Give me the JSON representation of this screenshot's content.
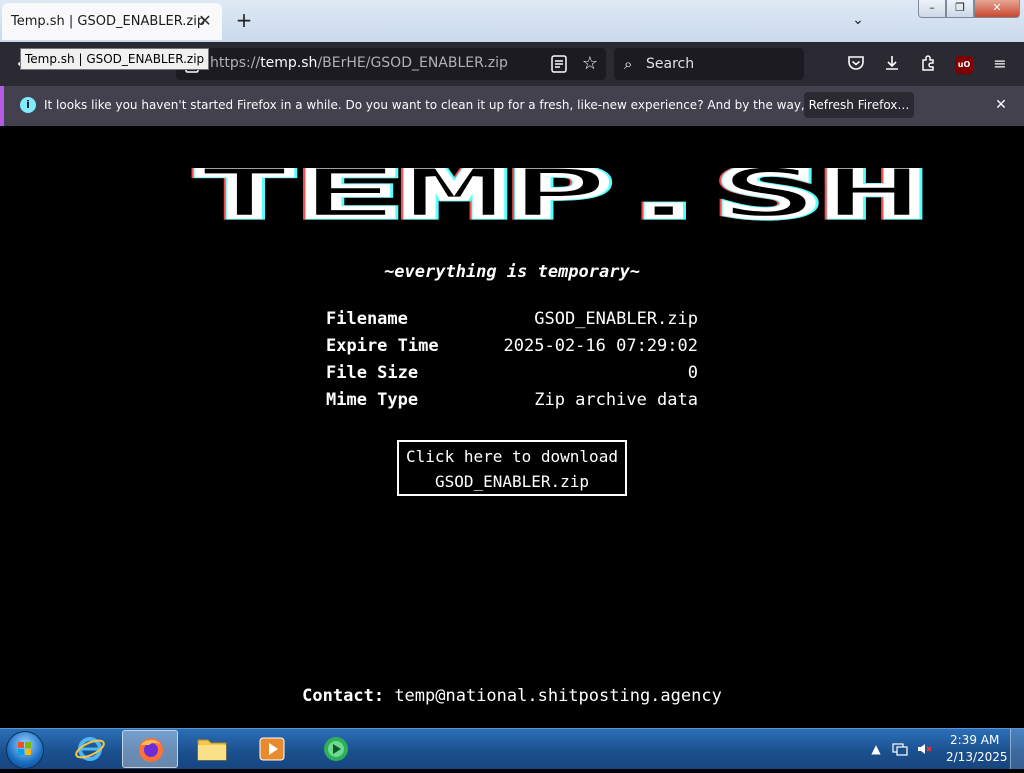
{
  "browser": {
    "tab_title": "Temp.sh | GSOD_ENABLER.zip",
    "tab_tooltip": "Temp.sh | GSOD_ENABLER.zip",
    "tab_close": "✕",
    "new_tab": "+",
    "url_scheme": "https://",
    "url_host": "temp.sh",
    "url_path": "/BErHE/GSOD_ENABLER.zip",
    "search_placeholder": "Search"
  },
  "notification": {
    "message": "It looks like you haven't started Firefox in a while. Do you want to clean it up for a fresh, like-new experience? And by the way, welcome back!",
    "button_label": "Refresh Firefox…",
    "info_glyph": "i"
  },
  "page": {
    "logo_text": "TEMP.SH",
    "tagline": "~everything is temporary~",
    "details": [
      {
        "key": "Filename",
        "value": "GSOD_ENABLER.zip"
      },
      {
        "key": "Expire Time",
        "value": "2025-02-16 07:29:02"
      },
      {
        "key": "File Size",
        "value": "0"
      },
      {
        "key": "Mime Type",
        "value": "Zip archive data"
      }
    ],
    "download_line1": "Click here to download",
    "download_line2": "GSOD_ENABLER.zip",
    "contact_label": "Contact:",
    "contact_email": "temp@national.shitposting.agency"
  },
  "taskbar": {
    "time": "2:39 AM",
    "date": "2/13/2025"
  },
  "colors": {
    "page_bg": "#000000",
    "toolbar": "#2b2a33",
    "notification_bar": "#42414d",
    "accent": "#b35ae6",
    "taskbar": "#1a4f8c"
  }
}
